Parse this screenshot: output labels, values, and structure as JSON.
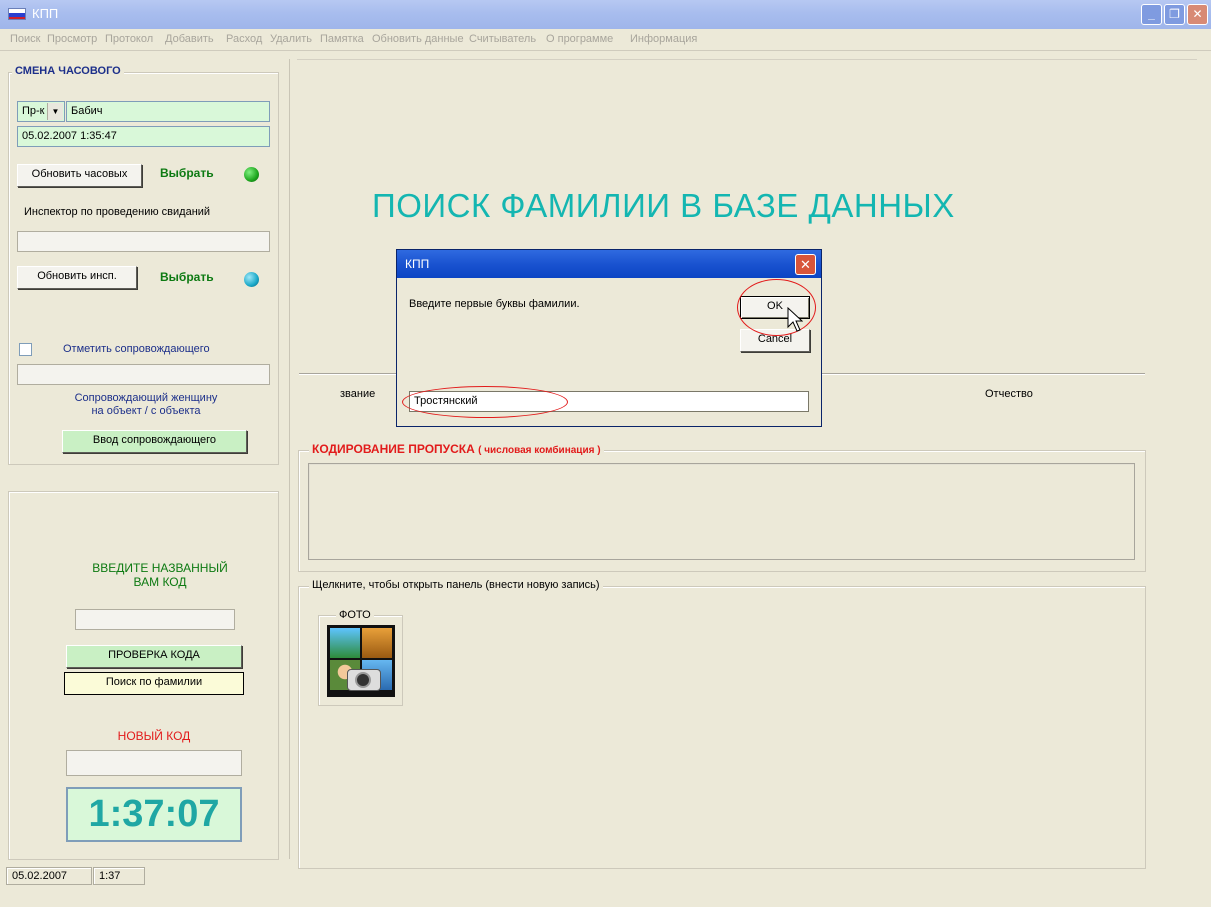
{
  "window": {
    "title": "КПП",
    "controls": {
      "minimize": "_",
      "restore": "❐",
      "close": "✕"
    }
  },
  "menu": [
    "Поиск",
    "Просмотр",
    "Протокол",
    "Добавить",
    "Расход",
    "Удалить",
    "Памятка",
    "Обновить данные",
    "Считыватель",
    "О программе",
    "Информация"
  ],
  "shift_panel": {
    "caption": "СМЕНА ЧАСОВОГО",
    "rank_select": "Пр-к",
    "guard_name": "Бабич",
    "datetime": "05.02.2007 1:35:47",
    "update_guards_button": "Обновить часовых",
    "select_label_1": "Выбрать",
    "inspector_label": "Инспектор по проведению свиданий",
    "inspector_value": "",
    "update_inspector_button": "Обновить инсп.",
    "select_label_2": "Выбрать",
    "escort_checkbox_label": "Отметить сопровождающего",
    "escort_value": "",
    "escort_note_line1": "Сопровождающий женщину",
    "escort_note_line2": "на объект / с объекта",
    "escort_button": "Ввод сопровождающего",
    "led1_color": "#1ea61e",
    "led2_color": "#19a8c8"
  },
  "code_panel": {
    "prompt_line1": "ВВЕДИТЕ НАЗВАННЫЙ",
    "prompt_line2": "ВАМ КОД",
    "code_value": "",
    "check_button": "ПРОВЕРКА КОДА",
    "search_button": "Поиск по фамилии",
    "new_code_label": "НОВЫЙ КОД",
    "new_code_value": "",
    "clock": "1:37:07"
  },
  "main": {
    "heading": "ПОИСК ФАМИЛИИ В БАЗЕ ДАННЫХ",
    "col_rank": "звание",
    "col_patronymic": "Отчество",
    "coding_caption": "КОДИРОВАНИЕ ПРОПУСКА",
    "coding_caption_sub": "( числовая комбинация )",
    "panel_caption": "Щелкните, чтобы открыть панель (внести новую запись)",
    "photo_caption": "ФОТО"
  },
  "dialog": {
    "title": "КПП",
    "prompt": "Введите первые буквы фамилии.",
    "ok_button": "OK",
    "cancel_button": "Cancel",
    "input_value": "Тростянский"
  },
  "status": {
    "date": "05.02.2007",
    "time": "1:37"
  },
  "colors": {
    "heading": "#14b6b1",
    "annotation": "#e21b1b",
    "field_green": "#d9f8d9"
  }
}
